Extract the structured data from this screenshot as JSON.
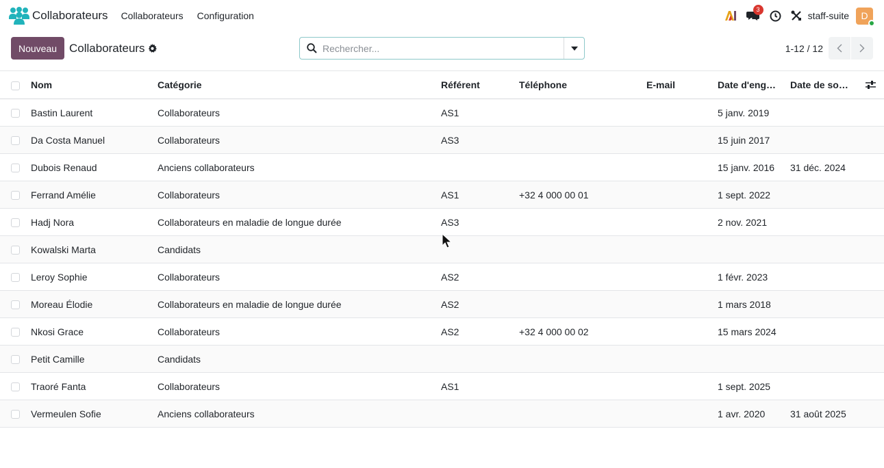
{
  "navbar": {
    "app_name": "Collaborateurs",
    "brand_icon": "people-icon",
    "menu": [
      {
        "label": "Collaborateurs"
      },
      {
        "label": "Configuration"
      }
    ],
    "notifications_count": "3",
    "db_name": "staff-suite",
    "avatar_initial": "D",
    "colors": {
      "brand": "#21b3bb",
      "avatar": "#f0a35a",
      "badge": "#d9372f"
    }
  },
  "control_panel": {
    "new_button": "Nouveau",
    "title": "Collaborateurs",
    "search_placeholder": "Rechercher...",
    "pager": "1-12 / 12",
    "colors": {
      "primary": "#714b67",
      "search_border": "#8cc8c9"
    }
  },
  "table": {
    "columns": [
      "Nom",
      "Catégorie",
      "Référent",
      "Téléphone",
      "E-mail",
      "Date d'enga...",
      "Date de sortie"
    ],
    "rows": [
      {
        "nom": "Bastin Laurent",
        "categorie": "Collaborateurs",
        "referent": "AS1",
        "telephone": "",
        "email": "",
        "date_engagement": "5 janv. 2019",
        "date_sortie": ""
      },
      {
        "nom": "Da Costa Manuel",
        "categorie": "Collaborateurs",
        "referent": "AS3",
        "telephone": "",
        "email": "",
        "date_engagement": "15 juin 2017",
        "date_sortie": ""
      },
      {
        "nom": "Dubois Renaud",
        "categorie": "Anciens collaborateurs",
        "referent": "",
        "telephone": "",
        "email": "",
        "date_engagement": "15 janv. 2016",
        "date_sortie": "31 déc. 2024"
      },
      {
        "nom": "Ferrand Amélie",
        "categorie": "Collaborateurs",
        "referent": "AS1",
        "telephone": "+32 4 000 00 01",
        "email": "",
        "date_engagement": "1 sept. 2022",
        "date_sortie": ""
      },
      {
        "nom": "Hadj Nora",
        "categorie": "Collaborateurs en maladie de longue durée",
        "referent": "AS3",
        "telephone": "",
        "email": "",
        "date_engagement": "2 nov. 2021",
        "date_sortie": ""
      },
      {
        "nom": "Kowalski Marta",
        "categorie": "Candidats",
        "referent": "",
        "telephone": "",
        "email": "",
        "date_engagement": "",
        "date_sortie": ""
      },
      {
        "nom": "Leroy Sophie",
        "categorie": "Collaborateurs",
        "referent": "AS2",
        "telephone": "",
        "email": "",
        "date_engagement": "1 févr. 2023",
        "date_sortie": ""
      },
      {
        "nom": "Moreau Élodie",
        "categorie": "Collaborateurs en maladie de longue durée",
        "referent": "AS2",
        "telephone": "",
        "email": "",
        "date_engagement": "1 mars 2018",
        "date_sortie": ""
      },
      {
        "nom": "Nkosi Grace",
        "categorie": "Collaborateurs",
        "referent": "AS2",
        "telephone": "+32 4 000 00 02",
        "email": "",
        "date_engagement": "15 mars 2024",
        "date_sortie": ""
      },
      {
        "nom": "Petit Camille",
        "categorie": "Candidats",
        "referent": "",
        "telephone": "",
        "email": "",
        "date_engagement": "",
        "date_sortie": ""
      },
      {
        "nom": "Traoré Fanta",
        "categorie": "Collaborateurs",
        "referent": "AS1",
        "telephone": "",
        "email": "",
        "date_engagement": "1 sept. 2025",
        "date_sortie": ""
      },
      {
        "nom": "Vermeulen Sofie",
        "categorie": "Anciens collaborateurs",
        "referent": "",
        "telephone": "",
        "email": "",
        "date_engagement": "1 avr. 2020",
        "date_sortie": "31 août 2025"
      }
    ]
  }
}
